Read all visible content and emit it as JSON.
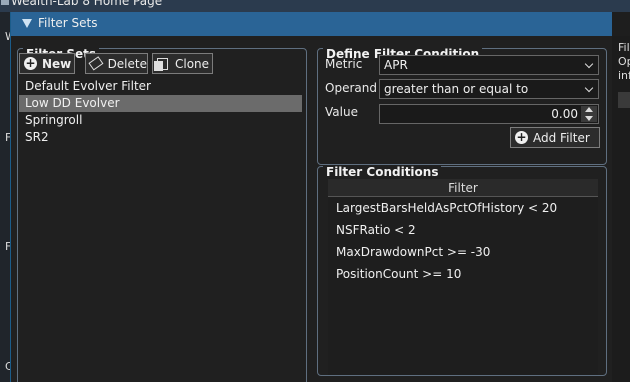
{
  "background": {
    "title": "Wealth-Lab 8 Home Page",
    "left_letters": [
      "W",
      "F",
      "F",
      "C"
    ],
    "right_text": [
      "Fil",
      "Op",
      "inf"
    ]
  },
  "dialog": {
    "title": "Filter Sets"
  },
  "filter_sets": {
    "group_title": "Filter Sets",
    "new_label": "New",
    "delete_label": "Delete",
    "clone_label": "Clone",
    "items": [
      {
        "label": "Default Evolver Filter",
        "selected": false
      },
      {
        "label": "Low DD Evolver",
        "selected": true
      },
      {
        "label": "Springroll",
        "selected": false
      },
      {
        "label": "SR2",
        "selected": false
      }
    ]
  },
  "define_condition": {
    "group_title": "Define Filter Condition",
    "metric_label": "Metric",
    "metric_value": "APR",
    "operand_label": "Operand",
    "operand_value": "greater than or equal to",
    "value_label": "Value",
    "value_value": "0.00",
    "add_filter_label": "Add Filter"
  },
  "conditions": {
    "group_title": "Filter Conditions",
    "column_header": "Filter",
    "rows": [
      "LargestBarsHeldAsPctOfHistory < 20",
      "NSFRatio < 2",
      "MaxDrawdownPct >= -30",
      "PositionCount >= 10"
    ]
  }
}
